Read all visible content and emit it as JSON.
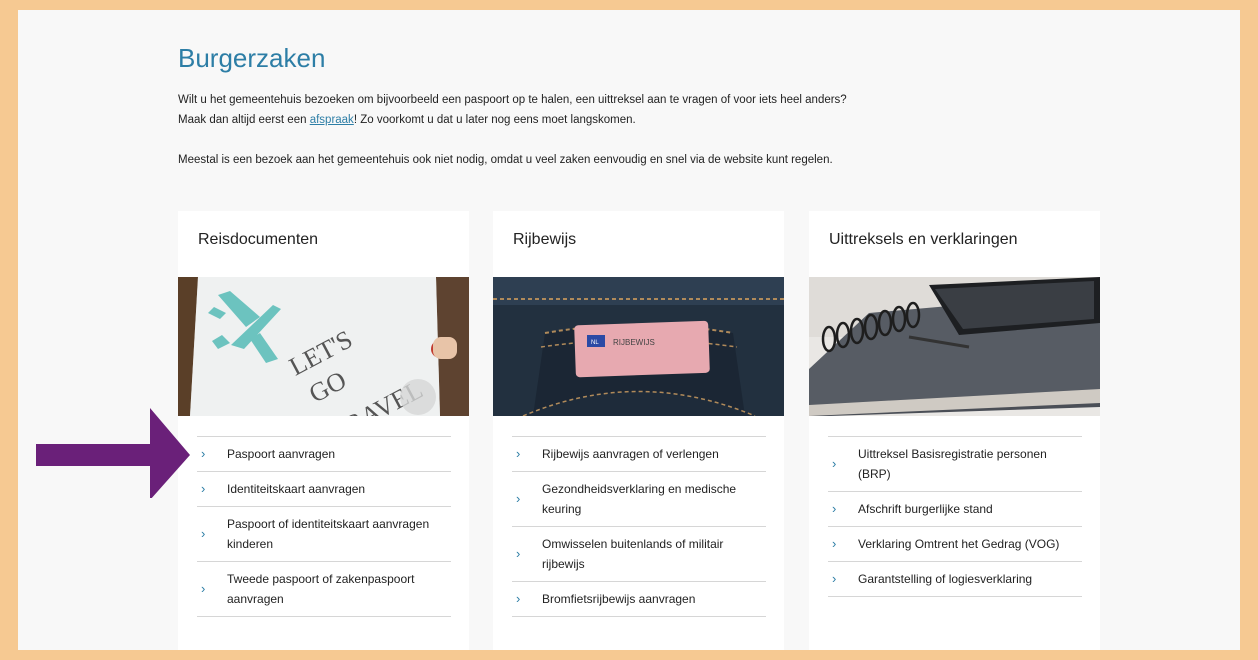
{
  "page": {
    "title": "Burgerzaken",
    "intro_1_before": "Wilt u het gemeentehuis bezoeken om bijvoorbeeld een paspoort op te halen, een uittreksel aan te vragen of voor iets heel anders? Maak dan altijd eerst een ",
    "intro_1_link": "afspraak",
    "intro_1_after": "! Zo voorkomt u dat u later nog eens moet langskomen.",
    "intro_2": "Meestal is een bezoek aan het gemeentehuis ook niet nodig, omdat u veel zaken eenvoudig en snel via de website kunt regelen."
  },
  "cards": [
    {
      "title": "Reisdocumenten",
      "image_text": [
        "LET'S",
        "GO",
        "TRAVEL"
      ],
      "items": [
        "Paspoort aanvragen",
        "Identiteitskaart aanvragen",
        "Paspoort of identiteitskaart aanvragen kinderen",
        "Tweede paspoort of zakenpaspoort aanvragen"
      ]
    },
    {
      "title": "Rijbewijs",
      "image_text": [
        "RIJBEWIJS",
        "NL"
      ],
      "items": [
        "Rijbewijs aanvragen of verlengen",
        "Gezondheidsverklaring en medische keuring",
        "Omwisselen buitenlands of militair rijbewijs",
        "Bromfietsrijbewijs aanvragen"
      ]
    },
    {
      "title": "Uittreksels en verklaringen",
      "items": [
        "Uittreksel Basisregistratie personen (BRP)",
        "Afschrift burgerlijke stand",
        "Verklaring Omtrent het Gedrag (VOG)",
        "Garantstelling of logiesverklaring"
      ]
    }
  ],
  "icons": {
    "chevron": "›",
    "annotation_arrow": "arrow-right-icon"
  },
  "colors": {
    "accent": "#2d7ea6",
    "frame": "#f6c992",
    "arrow": "#6a2079"
  }
}
